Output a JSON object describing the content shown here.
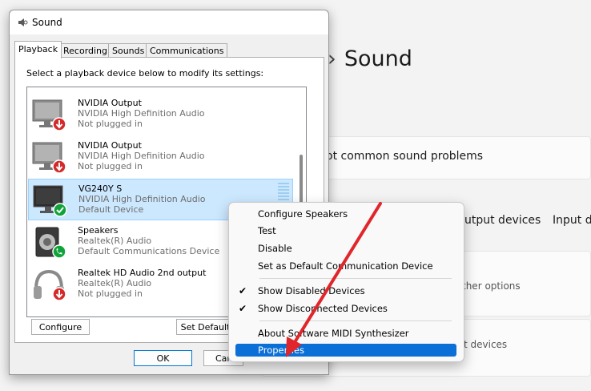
{
  "background": {
    "title_prefix": "›",
    "title": "Sound",
    "troubleshoot_text": "ot common sound problems",
    "output_devices_link": "utput devices",
    "input_devices_link": "Input d",
    "more_options_text": "ther options",
    "devices_text": "t devices"
  },
  "dialog": {
    "title": "Sound",
    "tabs": [
      "Playback",
      "Recording",
      "Sounds",
      "Communications"
    ],
    "instruction": "Select a playback device below to modify its settings:",
    "devices": [
      {
        "name": "NVIDIA Output",
        "driver": "NVIDIA High Definition Audio",
        "status": "Not plugged in",
        "icon": "monitor-icon",
        "badge": "unplugged-badge-icon"
      },
      {
        "name": "NVIDIA Output",
        "driver": "NVIDIA High Definition Audio",
        "status": "Not plugged in",
        "icon": "monitor-icon",
        "badge": "unplugged-badge-icon"
      },
      {
        "name": "VG240Y S",
        "driver": "NVIDIA High Definition Audio",
        "status": "Default Device",
        "icon": "monitor-icon",
        "badge": "default-check-badge-icon"
      },
      {
        "name": "Speakers",
        "driver": "Realtek(R) Audio",
        "status": "Default Communications Device",
        "icon": "speaker-icon",
        "badge": "phone-badge-icon"
      },
      {
        "name": "Realtek HD Audio 2nd output",
        "driver": "Realtek(R) Audio",
        "status": "Not plugged in",
        "icon": "headphones-icon",
        "badge": "unplugged-badge-icon"
      }
    ],
    "configure_button": "Configure",
    "set_default_button": "Set Default",
    "ok_button": "OK",
    "cancel_button": "Canc"
  },
  "context_menu": {
    "items": [
      {
        "label": "Configure Speakers",
        "checked": false
      },
      {
        "label": "Test",
        "checked": false
      },
      {
        "label": "Disable",
        "checked": false
      },
      {
        "label": "Set as Default Communication Device",
        "checked": false
      },
      {
        "label": "Show Disabled Devices",
        "checked": true
      },
      {
        "label": "Show Disconnected Devices",
        "checked": true
      },
      {
        "label": "About Software MIDI Synthesizer",
        "checked": false
      },
      {
        "label": "Properties",
        "checked": false,
        "highlighted": true
      }
    ],
    "check_glyph": "✔"
  },
  "colors": {
    "accent": "#0a6fd6",
    "selection": "#cce8ff",
    "annotation_arrow": "#e0262b",
    "unplugged_badge": "#d42a2a",
    "ok_badge": "#10a33a"
  }
}
